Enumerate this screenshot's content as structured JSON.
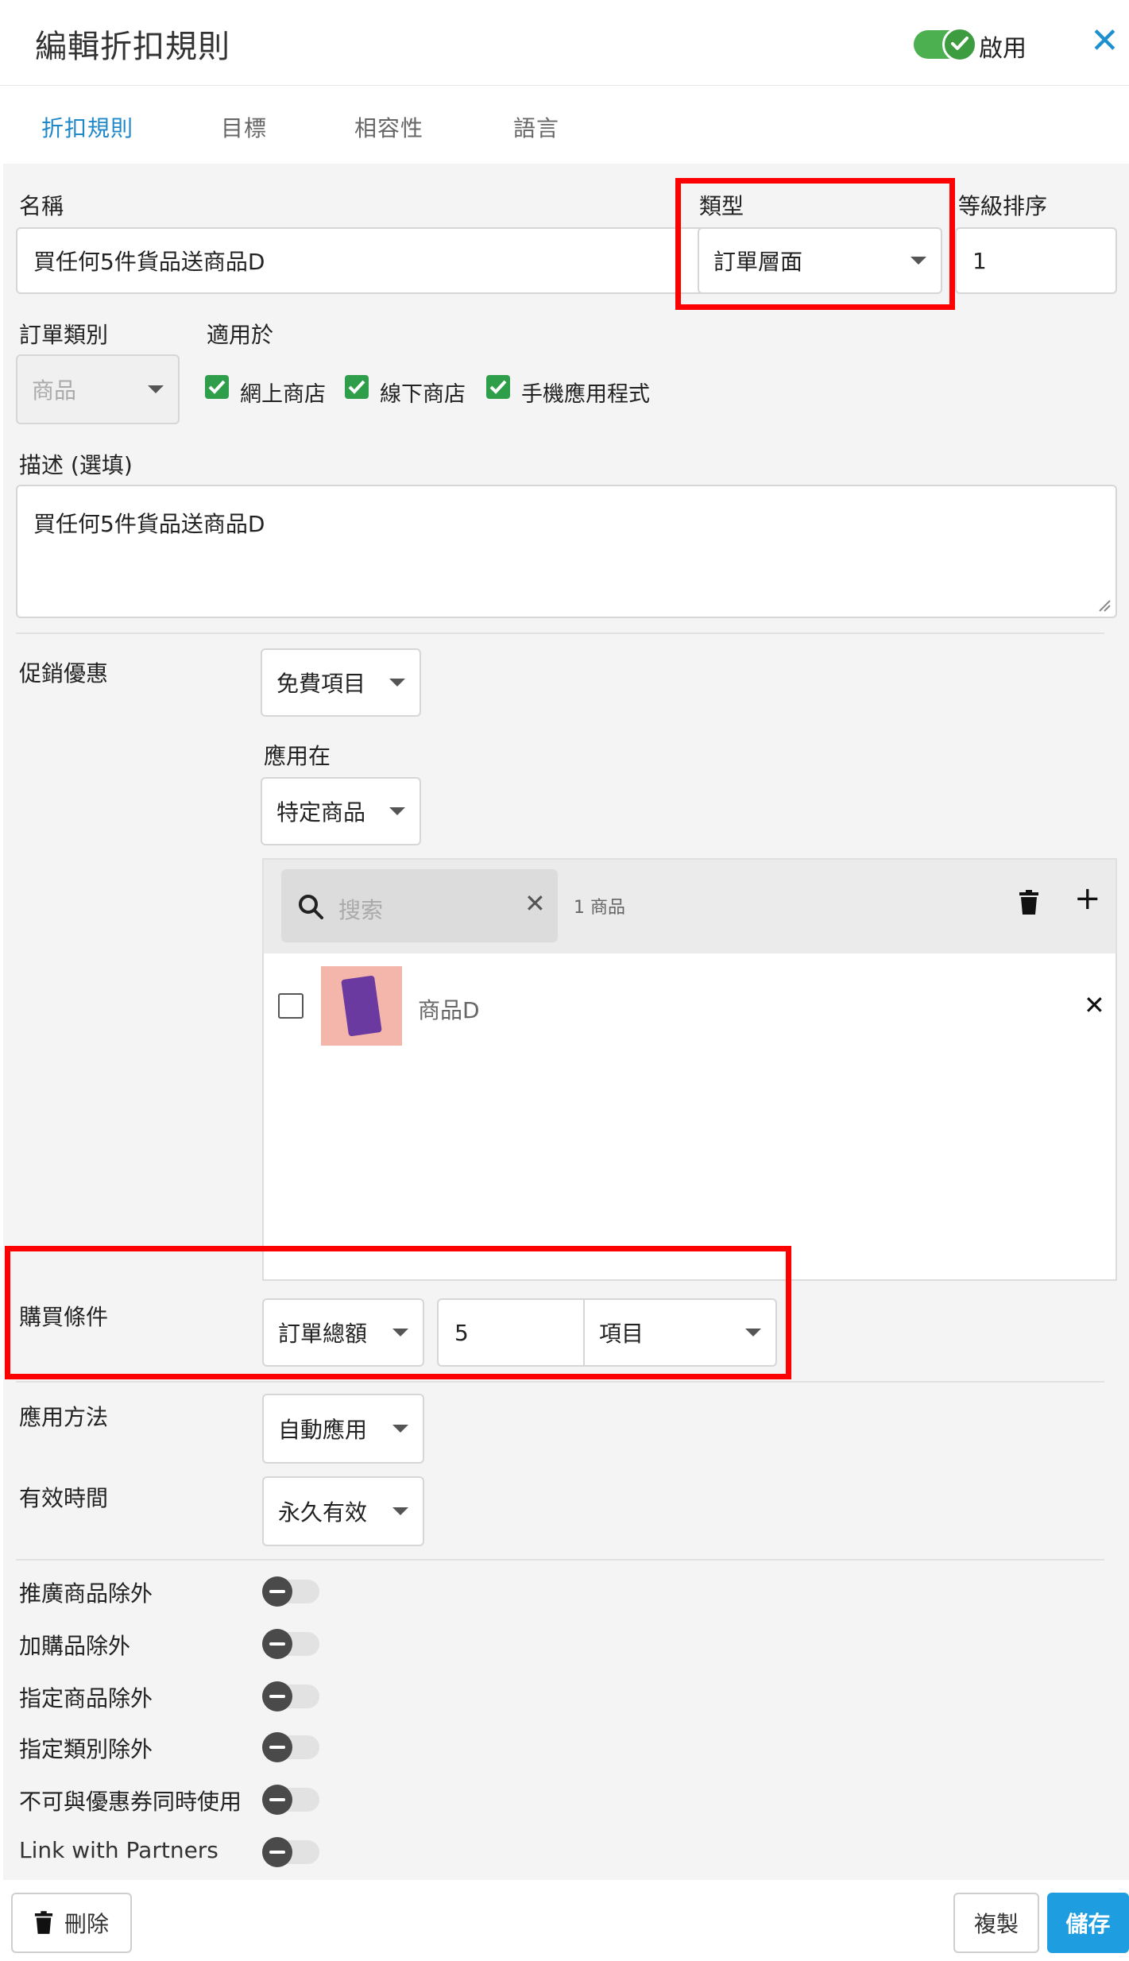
{
  "header": {
    "title": "編輯折扣規則",
    "enable_label": "啟用",
    "enabled": true
  },
  "tabs": [
    {
      "label": "折扣規則",
      "active": true
    },
    {
      "label": "目標",
      "active": false
    },
    {
      "label": "相容性",
      "active": false
    },
    {
      "label": "語言",
      "active": false
    }
  ],
  "form": {
    "name_label": "名稱",
    "name_value": "買任何5件貨品送商品D",
    "type_label": "類型",
    "type_value": "訂單層面",
    "rank_label": "等級排序",
    "rank_value": "1",
    "order_category_label": "訂單類別",
    "order_category_value": "商品",
    "applies_to_label": "適用於",
    "channels": [
      {
        "label": "網上商店",
        "checked": true
      },
      {
        "label": "線下商店",
        "checked": true
      },
      {
        "label": "手機應用程式",
        "checked": true
      }
    ],
    "desc_label": "描述 (選填)",
    "desc_value": "買任何5件貨品送商品D"
  },
  "promo": {
    "label": "促銷優惠",
    "offer_value": "免費項目",
    "apply_on_label": "應用在",
    "apply_on_value": "特定商品",
    "search_placeholder": "搜索",
    "product_count": "1 商品",
    "products": [
      {
        "name": "商品D",
        "checked": false
      }
    ]
  },
  "purchase": {
    "label": "購買條件",
    "condition_value": "訂單總額",
    "quantity_value": "5",
    "unit_value": "項目"
  },
  "method": {
    "label": "應用方法",
    "value": "自動應用"
  },
  "validity": {
    "label": "有效時間",
    "value": "永久有效"
  },
  "exclusions": [
    {
      "label": "推廣商品除外",
      "on": false
    },
    {
      "label": "加購品除外",
      "on": false
    },
    {
      "label": "指定商品除外",
      "on": false
    },
    {
      "label": "指定類別除外",
      "on": false
    },
    {
      "label": "不可與優惠券同時使用",
      "on": false
    },
    {
      "label": "Link with Partners",
      "on": false
    }
  ],
  "footer": {
    "delete_label": "刪除",
    "copy_label": "複製",
    "save_label": "儲存"
  },
  "colors": {
    "accent": "#1e9ee0",
    "toggle_on": "#4caf50",
    "checkbox": "#2e9e4a",
    "highlight": "#ff0000"
  }
}
